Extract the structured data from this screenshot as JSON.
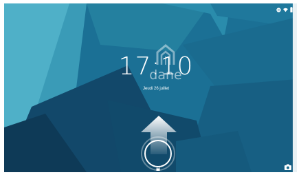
{
  "status_bar": {
    "icons": [
      "do-not-disturb-icon",
      "wifi-icon",
      "battery-icon"
    ]
  },
  "lockscreen": {
    "time": "17:10",
    "date": "Jeudi 26 juillet",
    "watermark_text": "dane",
    "unlock_icon": "lock-icon",
    "camera_icon": "camera-icon",
    "swipe_hint_icon": "up-arrow-icon"
  },
  "colors": {
    "wallpaper_base": "#1a6e92",
    "wallpaper_light": "#3d9db8",
    "wallpaper_dark": "#0f3f5e",
    "wallpaper_mid": "#24809f",
    "text": "#ffffff"
  }
}
